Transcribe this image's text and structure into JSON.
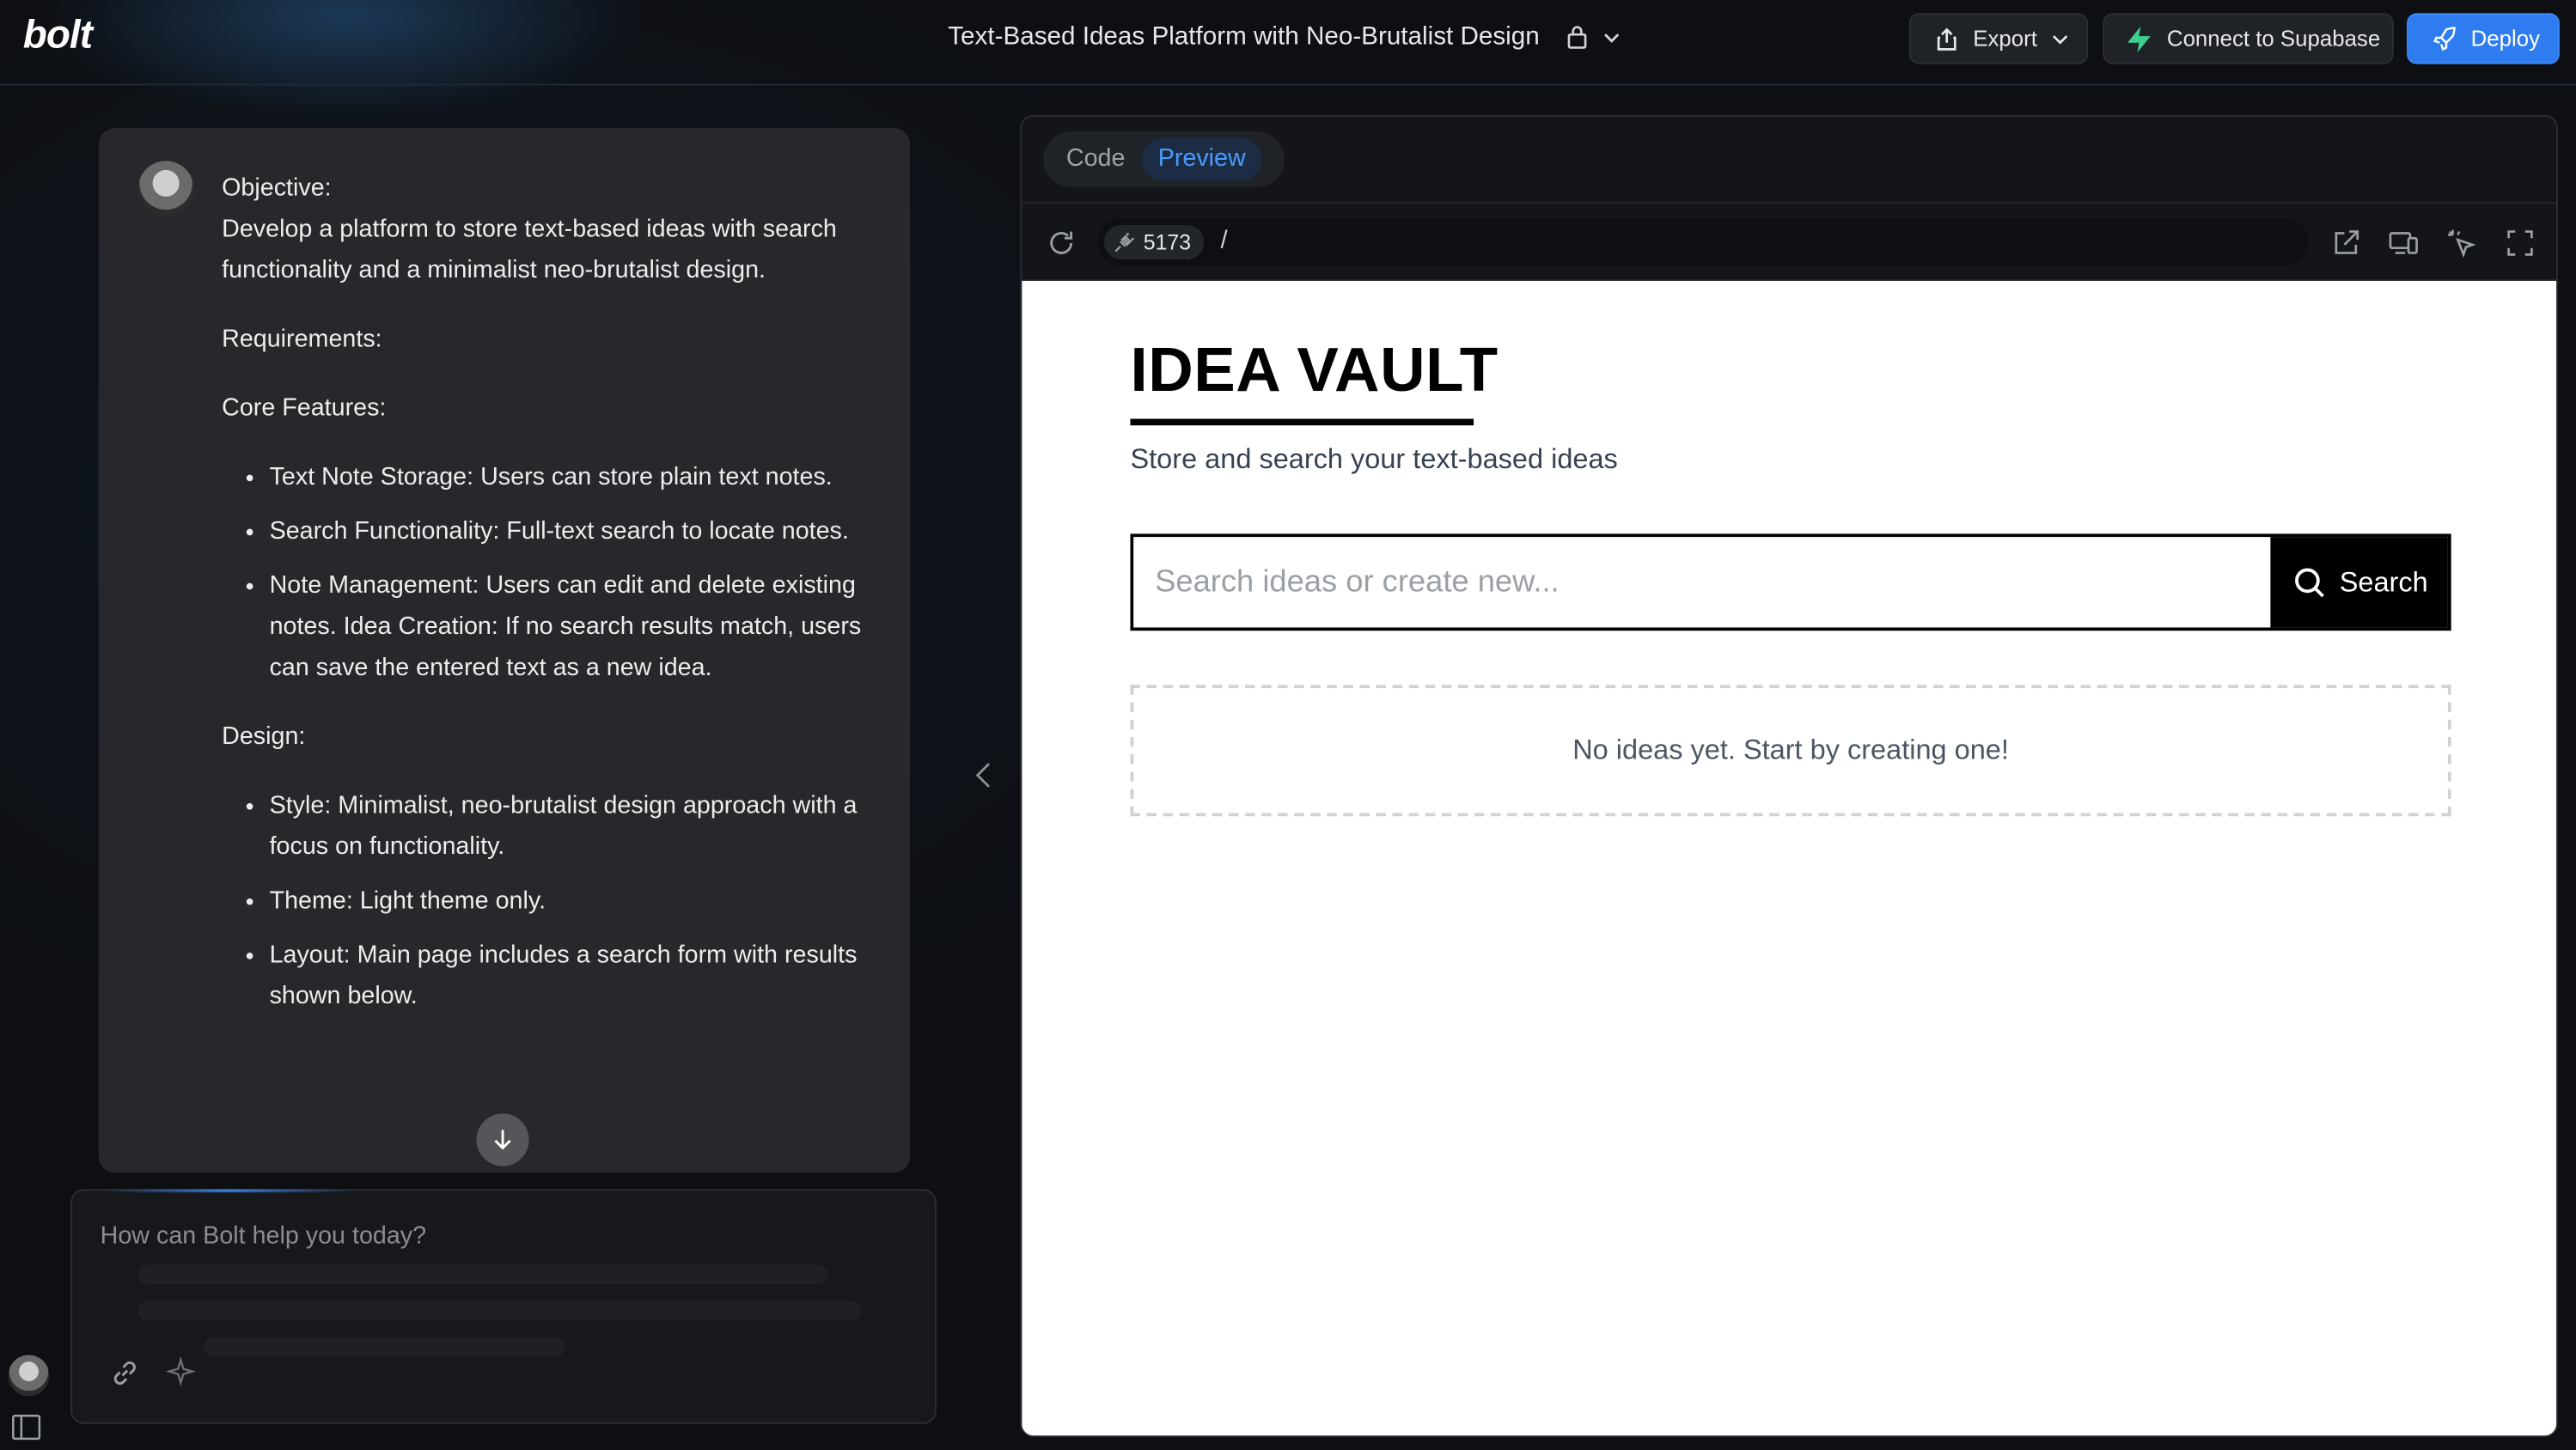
{
  "header": {
    "logo": "bolt",
    "project_title": "Text-Based Ideas Platform with Neo-Brutalist Design",
    "export_label": "Export",
    "supabase_label": "Connect to Supabase",
    "deploy_label": "Deploy",
    "deploy_color": "#2f7cf0",
    "supabase_color": "#3ecf8e"
  },
  "chat": {
    "objective_heading": "Objective:",
    "objective_text": "Develop a platform to store text-based ideas with search functionality and a minimalist neo-brutalist design.",
    "requirements_heading": "Requirements:",
    "core_heading": "Core Features:",
    "core_items": [
      "Text Note Storage: Users can store plain text notes.",
      "Search Functionality: Full-text search to locate notes.",
      "Note Management: Users can edit and delete existing notes. Idea Creation: If no search results match, users can save the entered text as a new idea."
    ],
    "design_heading": "Design:",
    "design_items": [
      "Style: Minimalist, neo-brutalist design approach with a focus on functionality.",
      "Theme: Light theme only.",
      "Layout: Main page includes a search form with results shown below."
    ]
  },
  "prompt": {
    "placeholder": "How can Bolt help you today?"
  },
  "workbench": {
    "tabs": [
      {
        "label": "Code",
        "active": false
      },
      {
        "label": "Preview",
        "active": true
      }
    ],
    "port": "5173",
    "path": "/",
    "accent_color": "#4b9bff"
  },
  "preview": {
    "title": "IDEA VAULT",
    "subtitle": "Store and search your text-based ideas",
    "search_placeholder": "Search ideas or create new...",
    "search_button": "Search",
    "empty_message": "No ideas yet. Start by creating one!"
  }
}
